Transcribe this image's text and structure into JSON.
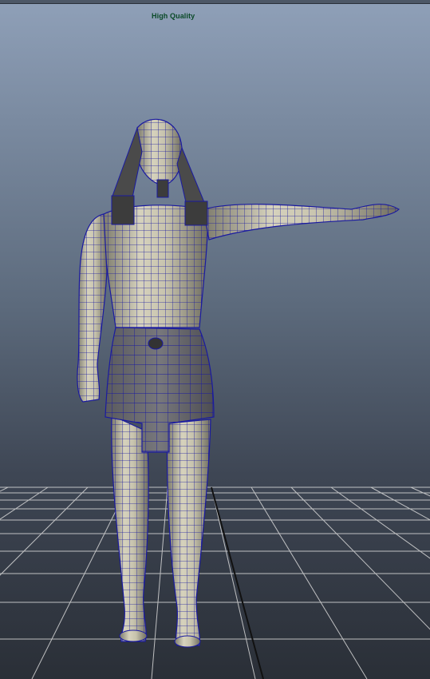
{
  "viewport": {
    "hud_label": "High Quality"
  },
  "colors": {
    "background_top": "#8fa0b8",
    "background_bottom": "#2a2f37",
    "grid_lines": "#d8d8d8",
    "wireframe": "#1a1aa0",
    "mesh_surface": "#b9b6a3",
    "headdress": "#4a4a4a",
    "hud_text": "#0a4a28"
  },
  "scene": {
    "object": "character-mesh",
    "display_mode": "smooth-shade-wireframe-on-shaded",
    "grid_visible": true
  }
}
